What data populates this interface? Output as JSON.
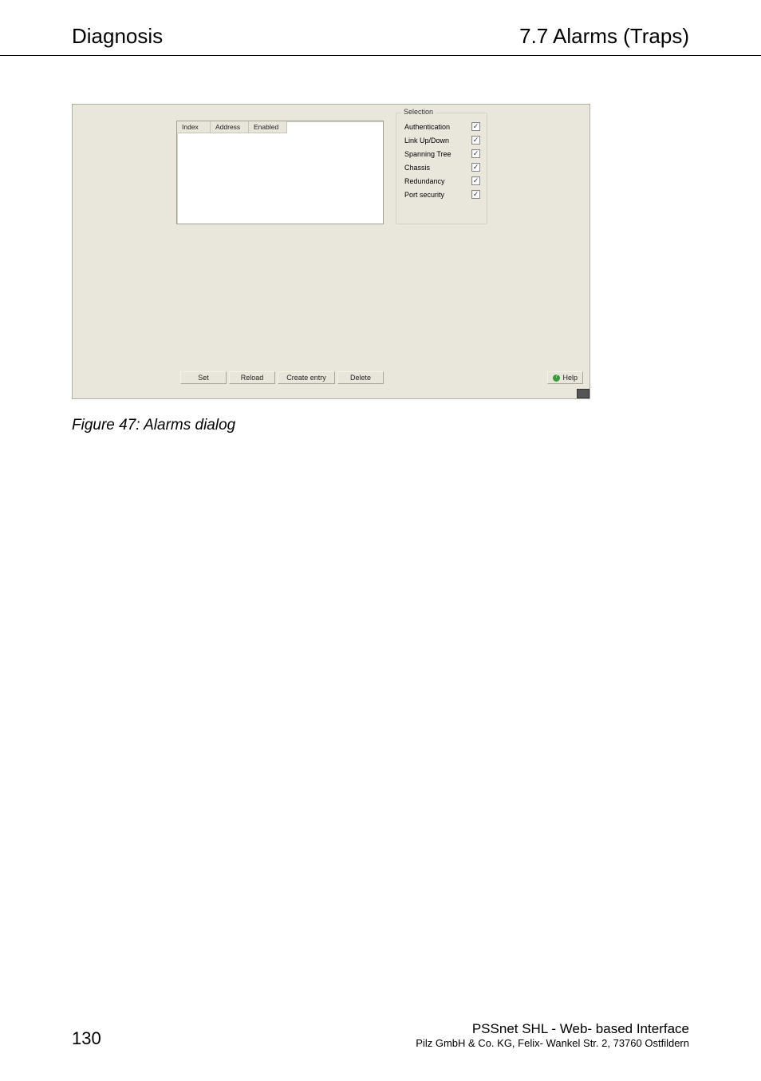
{
  "header": {
    "left": "Diagnosis",
    "right": "7.7 Alarms (Traps)"
  },
  "dialog": {
    "table": {
      "columns": [
        "Index",
        "Address",
        "Enabled"
      ]
    },
    "selection": {
      "legend": "Selection",
      "items": [
        {
          "label": "Authentication",
          "checked": true
        },
        {
          "label": "Link Up/Down",
          "checked": true
        },
        {
          "label": "Spanning Tree",
          "checked": true
        },
        {
          "label": "Chassis",
          "checked": true
        },
        {
          "label": "Redundancy",
          "checked": true
        },
        {
          "label": "Port security",
          "checked": true
        }
      ]
    },
    "buttons": {
      "set": "Set",
      "reload": "Reload",
      "create": "Create entry",
      "delete": "Delete",
      "help": "Help"
    }
  },
  "caption": "Figure 47: Alarms dialog",
  "footer": {
    "page": "130",
    "title": "PSSnet SHL - Web- based Interface",
    "company": "Pilz GmbH & Co. KG, Felix- Wankel Str. 2, 73760 Ostfildern"
  }
}
